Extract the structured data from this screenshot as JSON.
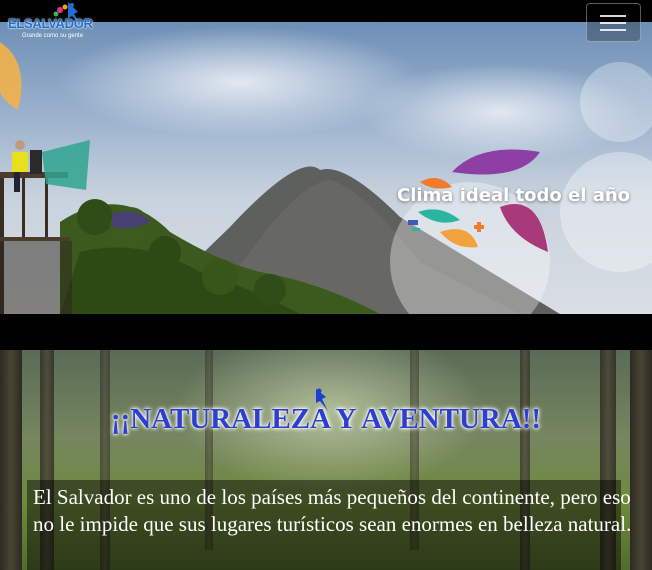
{
  "brand": {
    "name": "ELSALVADOR",
    "tagline": "Grande como su gente",
    "primary_color": "#1e6fd1"
  },
  "navbar": {
    "toggle_icon": "hamburger-menu-icon"
  },
  "hero": {
    "caption": "Clima ideal todo el año"
  },
  "section": {
    "title": "¡¡NATURALEZA Y AVENTURA!!",
    "title_color": "#2d3fcf",
    "description": "El Salvador es uno de los países más pequeños del continente, pero eso no le impide que sus lugares turísticos sean enormes en belleza natural."
  }
}
